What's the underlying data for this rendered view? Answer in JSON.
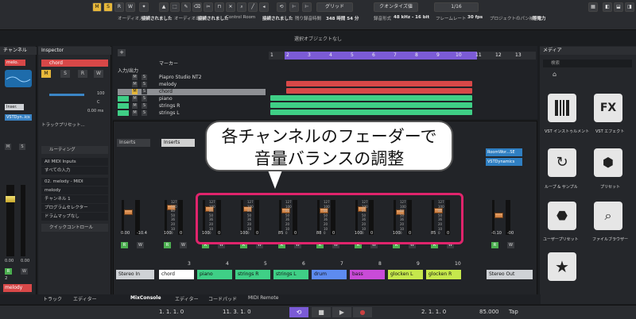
{
  "toolbar": {
    "mode_buttons": [
      "M",
      "S",
      "R",
      "W"
    ],
    "grid_label": "グリッド",
    "quantize_label": "クオンタイズ値",
    "quantize_value": "1/16",
    "row2": [
      {
        "label": "オーディオ入力",
        "value": "接続されました"
      },
      {
        "label": "オーディオ出力",
        "value": "接続されました"
      },
      {
        "label": "",
        "value": "Control Room"
      },
      {
        "label": "",
        "value": "接続されました"
      },
      {
        "label": "残り録音時間",
        "value": "348 時間 54 分"
      },
      {
        "label": "録音形式",
        "value": "48 kHz - 16 bit"
      },
      {
        "label": "フレームレート",
        "value": "30 fps"
      },
      {
        "label": "プロジェクトのパン補正",
        "value": ""
      },
      {
        "label": "",
        "value": "等電力"
      }
    ]
  },
  "status": "選択オブジェクトなし",
  "left_zone": {
    "tab": "チャンネル",
    "track": "melo.",
    "insert": "Inser.",
    "plugin": "VSTDyn..ics",
    "values": [
      "0.00",
      "0.00"
    ],
    "rw": [
      "R",
      "W"
    ],
    "number": "2",
    "name": "melody"
  },
  "inspector": {
    "tab": "Inspector",
    "track": "chord",
    "vol": "100",
    "pan": "C",
    "delay": "0.00 ms",
    "track_preset": "トラックプリセット...",
    "routing": "ルーティング",
    "input": "All MIDI Inputs",
    "channel_in": "すべての入力",
    "output": "02. melody - MIDI",
    "out_name": "melody",
    "channel": "チャンネル 1",
    "program": "プログラムセレクター",
    "drum": "ドラムマップなし",
    "quick": "クイックコントロール"
  },
  "tracks": {
    "header": [
      "マーカー",
      "入力/出力"
    ],
    "rows": [
      {
        "name": "Piapro Studio NT2"
      },
      {
        "name": "melody"
      },
      {
        "name": "chord",
        "selected": true
      },
      {
        "name": "piano"
      },
      {
        "name": "strings R"
      },
      {
        "name": "strings L"
      }
    ],
    "ruler": [
      "1",
      "2",
      "3",
      "4",
      "5",
      "6",
      "7",
      "8",
      "9",
      "10",
      "11",
      "12",
      "13"
    ]
  },
  "mixer": {
    "left_inserts": "Inserts",
    "right_inserts": "Inserts",
    "right_plugins": [
      "RoomWor...SE",
      "VSTDynamics"
    ],
    "strips": [
      {
        "name": "Stereo In",
        "color": "#cfd2d6",
        "num": "",
        "val1": "0.00",
        "val2": "-10.4",
        "pan": "C"
      },
      {
        "name": "chord",
        "color": "#ffffff",
        "num": "3",
        "val1": "100",
        "val2": "0",
        "pan": "C"
      },
      {
        "name": "piano",
        "color": "#3fcf86",
        "num": "4",
        "val1": "100",
        "val2": "0",
        "pan": "L"
      },
      {
        "name": "strings R",
        "color": "#3fcf86",
        "num": "5",
        "val1": "100",
        "val2": "0",
        "pan": "L"
      },
      {
        "name": "strings L",
        "color": "#3fcf86",
        "num": "6",
        "val1": "85",
        "val2": "0",
        "pan": "L"
      },
      {
        "name": "drum",
        "color": "#5d8bf0",
        "num": "7",
        "val1": "88",
        "val2": "0",
        "pan": "C"
      },
      {
        "name": "bass",
        "color": "#c94bd8",
        "num": "8",
        "val1": "100",
        "val2": "0",
        "pan": "C"
      },
      {
        "name": "glocken L",
        "color": "#c6e84c",
        "num": "9",
        "val1": "100",
        "val2": "0",
        "pan": "L"
      },
      {
        "name": "glocken R",
        "color": "#c6e84c",
        "num": "10",
        "val1": "85",
        "val2": "0",
        "pan": "C"
      },
      {
        "name": "Stereo Out",
        "color": "#cfd2d6",
        "num": "",
        "val1": "-0.10",
        "val2": "-00",
        "pan": ""
      }
    ],
    "pan_values": [
      "-14",
      "-21",
      "-48",
      "-72"
    ],
    "scale": [
      "127",
      "100",
      "80",
      "50",
      "36",
      "20",
      "10",
      "0"
    ]
  },
  "callout": {
    "line1": "各チャンネルのフェーダーで",
    "line2": "音量バランスの調整"
  },
  "media": {
    "tab": "メディア",
    "search": "検索",
    "tiles": [
      {
        "label": "VST インストゥルメント"
      },
      {
        "label": "VST エフェクト"
      },
      {
        "label": "ループ & サンプル"
      },
      {
        "label": "プリセット"
      },
      {
        "label": "ユーザープリセット"
      },
      {
        "label": "ファイルブラウザー"
      },
      {
        "label": "お気に入り"
      }
    ]
  },
  "lower_tabs": [
    "トラック",
    "エディター",
    "MixConsole",
    "エディター",
    "コードパッド",
    "MIDI Remote"
  ],
  "transport": {
    "pos_left": "1. 1. 1.  0",
    "pos_right": "11. 3. 1.  0",
    "pos_main": "2. 1. 1.  0",
    "tempo": "85.000",
    "tap": "Tap"
  }
}
